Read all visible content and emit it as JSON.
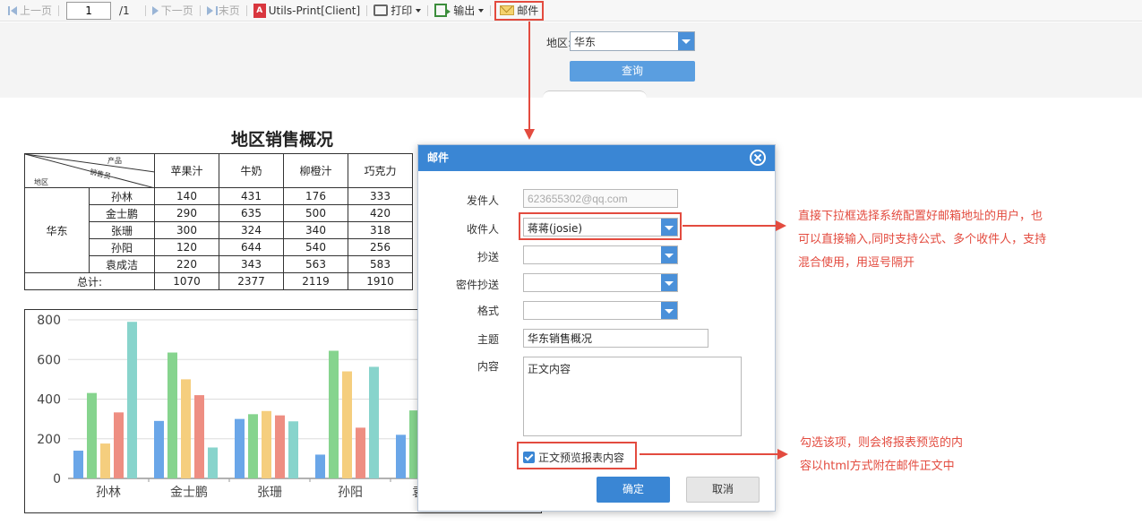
{
  "toolbar": {
    "prev_page": "上一页",
    "current_page": "1",
    "total_pages": "/1",
    "next_page": "下一页",
    "last_page": "末页",
    "pdf_icon_text": "A",
    "print_client": "Utils-Print[Client]",
    "print": "打印",
    "export": "输出",
    "mail": "邮件"
  },
  "params": {
    "region_label": "地区:",
    "region_value": "华东",
    "query_button": "查询"
  },
  "report": {
    "title": "地区销售概况",
    "corner": {
      "product": "产品",
      "salesperson": "销售员",
      "region": "地区"
    },
    "columns": [
      "苹果汁",
      "牛奶",
      "柳橙汁",
      "巧克力"
    ],
    "region": "华东",
    "rows": [
      {
        "name": "孙林",
        "values": [
          "140",
          "431",
          "176",
          "333"
        ]
      },
      {
        "name": "金士鹏",
        "values": [
          "290",
          "635",
          "500",
          "420"
        ]
      },
      {
        "name": "张珊",
        "values": [
          "300",
          "324",
          "340",
          "318"
        ]
      },
      {
        "name": "孙阳",
        "values": [
          "120",
          "644",
          "540",
          "256"
        ]
      },
      {
        "name": "袁成洁",
        "values": [
          "220",
          "343",
          "563",
          "583"
        ]
      }
    ],
    "total_label": "总计:",
    "totals": [
      "1070",
      "2377",
      "2119",
      "1910"
    ]
  },
  "chart_data": {
    "type": "bar",
    "categories": [
      "孙林",
      "金士鹏",
      "张珊",
      "孙阳",
      "袁成洁"
    ],
    "series": [
      {
        "values": [
          140,
          290,
          300,
          120,
          220
        ]
      },
      {
        "values": [
          431,
          635,
          324,
          644,
          343
        ]
      },
      {
        "values": [
          176,
          500,
          340,
          540,
          563
        ]
      },
      {
        "values": [
          333,
          420,
          318,
          256,
          583
        ]
      },
      {
        "values": [
          790,
          156,
          288,
          563,
          0
        ]
      }
    ],
    "colors": [
      "#6aa6e8",
      "#86d48e",
      "#f5ce7e",
      "#ee8e82",
      "#88d4cc"
    ],
    "yticks": [
      "0",
      "200",
      "400",
      "600",
      "800"
    ],
    "ylim": [
      0,
      800
    ],
    "grid": true
  },
  "dialog": {
    "title": "邮件",
    "sender_label": "发件人",
    "sender_value": "623655302@qq.com",
    "recipient_label": "收件人",
    "recipient_value": "蒋蒋(josie)",
    "cc_label": "抄送",
    "bcc_label": "密件抄送",
    "format_label": "格式",
    "subject_label": "主题",
    "subject_value": "华东销售概况",
    "content_label": "内容",
    "content_value": "正文内容",
    "preview_checkbox": "正文预览报表内容",
    "ok_button": "确定",
    "cancel_button": "取消"
  },
  "annotations": {
    "recipient_note": [
      "直接下拉框选择系统配置好邮箱地址的用户，也",
      "可以直接输入,同时支持公式、多个收件人，支持",
      "混合使用，用逗号隔开"
    ],
    "preview_note": [
      "勾选该项，则会将报表预览的内",
      "容以html方式附在邮件正文中"
    ]
  },
  "colors": {
    "accent": "#3a86d4",
    "annotation": "#e34b3f"
  }
}
